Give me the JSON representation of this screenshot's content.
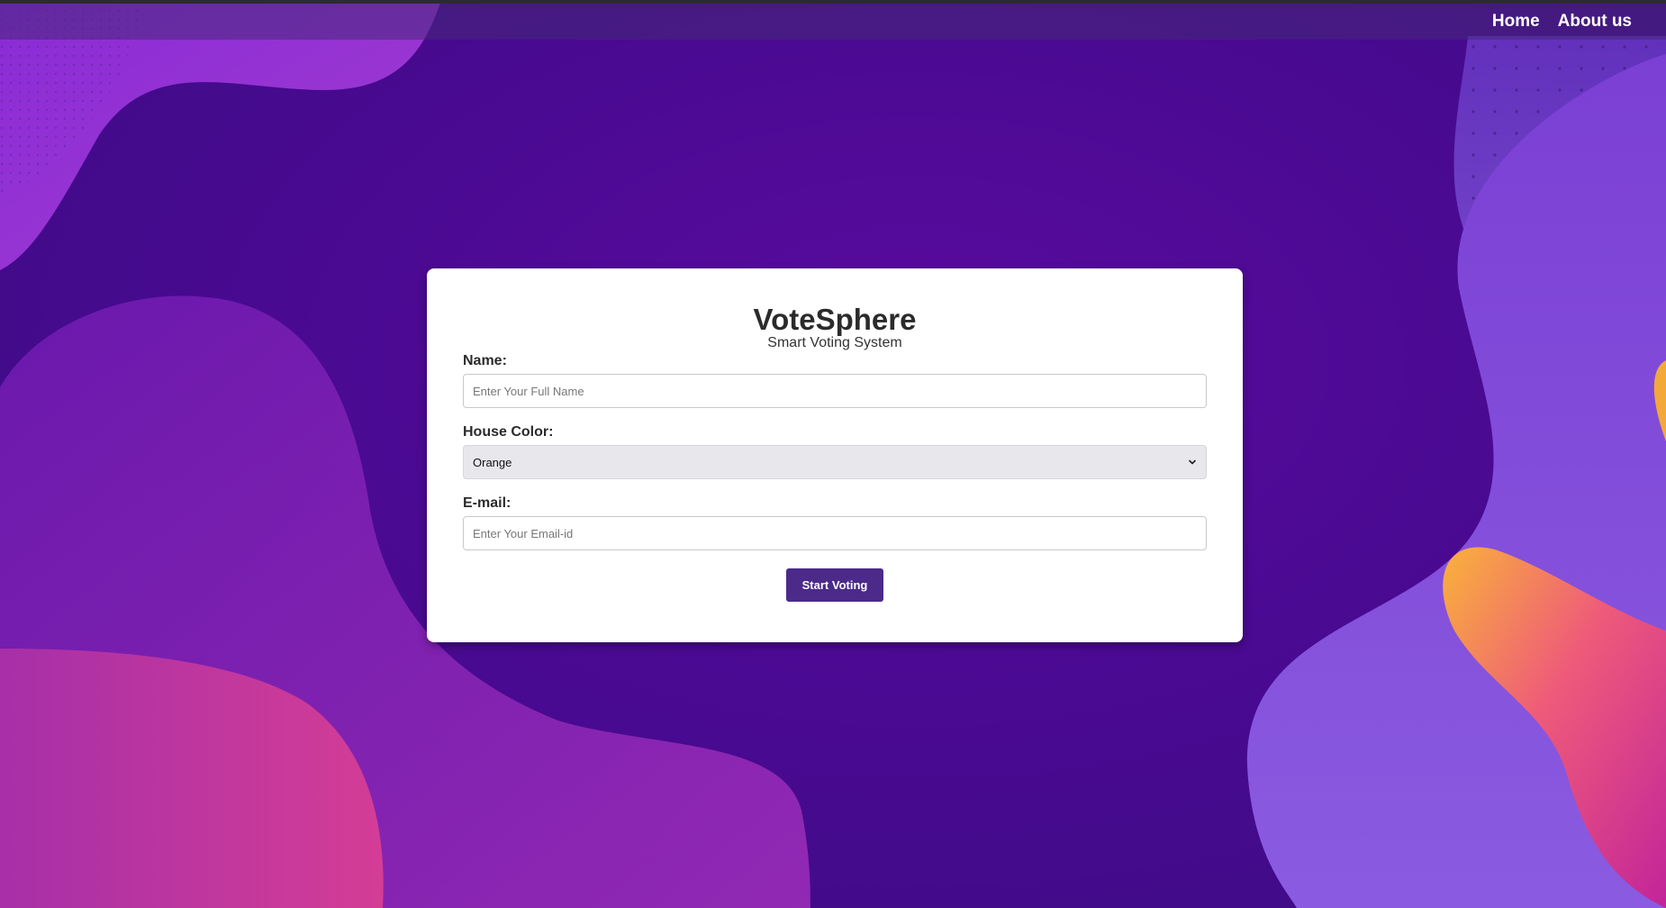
{
  "nav": {
    "links": [
      "Home",
      "About us"
    ]
  },
  "card": {
    "title": "VoteSphere",
    "subtitle": "Smart Voting System",
    "name": {
      "label": "Name:",
      "placeholder": "Enter Your Full Name",
      "value": ""
    },
    "house": {
      "label": "House Color:",
      "selected": "Orange"
    },
    "email": {
      "label": "E-mail:",
      "placeholder": "Enter Your Email-id",
      "value": ""
    },
    "submit_label": "Start Voting"
  },
  "colors": {
    "background": "#4a0a92",
    "accent": "#4b2a8a",
    "card": "#ffffff",
    "blob_pink": "#c03a9f",
    "blob_purple": "#7b4fd6",
    "blob_orange": "#f9a23b"
  },
  "icons": {
    "select_arrow": "chevron-down-icon"
  }
}
